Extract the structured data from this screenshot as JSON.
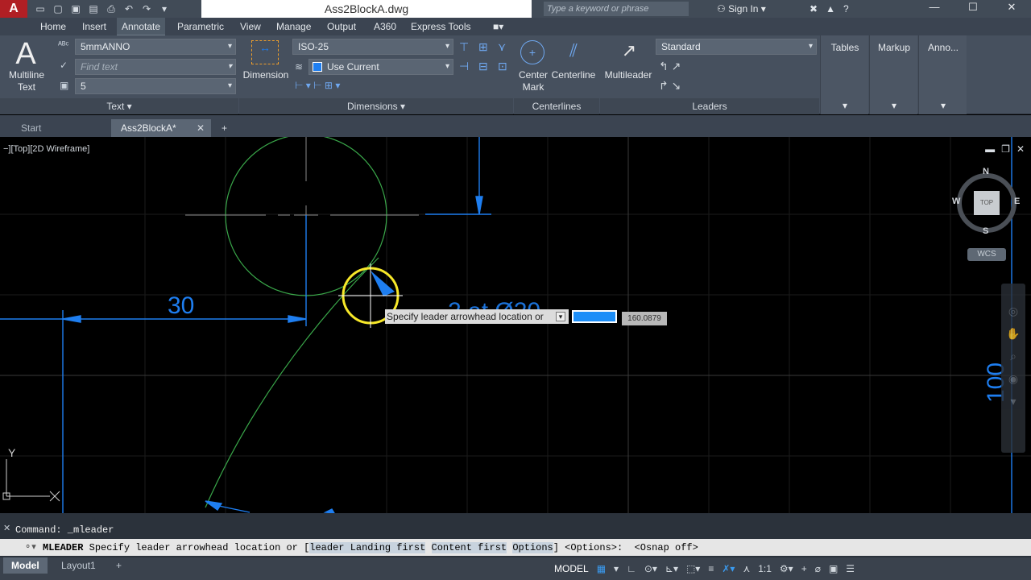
{
  "titlebar": {
    "app_letter": "A",
    "document_title": "Ass2BlockA.dwg",
    "search_placeholder": "Type a keyword or phrase",
    "sign_in": "Sign In"
  },
  "menu_tabs": [
    "Home",
    "Insert",
    "Annotate",
    "Parametric",
    "View",
    "Manage",
    "Output",
    "A360",
    "Express Tools"
  ],
  "active_tab": "Annotate",
  "ribbon": {
    "text_panel": {
      "multiline_label": "Multiline\nText",
      "style_combo": "5mmANNO",
      "find_placeholder": "Find text",
      "height_combo": "5",
      "footer": "Text ▾"
    },
    "dimensions_panel": {
      "dimension_label": "Dimension",
      "dimstyle_combo": "ISO-25",
      "layer_combo": "Use Current",
      "footer": "Dimensions ▾"
    },
    "centerlines_panel": {
      "center_mark_label": "Center\nMark",
      "centerline_label": "Centerline",
      "footer": "Centerlines"
    },
    "leaders_panel": {
      "multileader_label": "Multileader",
      "style_combo": "Standard",
      "footer": "Leaders"
    },
    "extra_panels": [
      "Tables",
      "Markup",
      "Anno..."
    ]
  },
  "file_tabs": {
    "start": "Start",
    "document": "Ass2BlockA*",
    "add": "+"
  },
  "viewport": {
    "label": "−][Top][2D Wireframe]",
    "viewcube": {
      "north": "N",
      "south": "S",
      "east": "E",
      "west": "W",
      "face": "TOP"
    },
    "wcs": "WCS",
    "dim_30": "30",
    "dim_100": "100",
    "axis_y": "Y",
    "axis_x": "X",
    "tooltip": "Specify leader arrowhead location or",
    "dynamic_value": "160.0879"
  },
  "command": {
    "history": "Command:  _mleader",
    "name": "MLEADER",
    "prompt": "Specify leader arrowhead location or [",
    "options": [
      "leader Landing first",
      "Content first",
      "Options"
    ],
    "tail": "] <Options>:  <Osnap off>"
  },
  "statusbar": {
    "model_tab": "Model",
    "layout_tab": "Layout1",
    "model_label": "MODEL",
    "scale": "1:1"
  },
  "colors": {
    "drawing_green": "#3aa84a",
    "dimension_blue": "#1e7ef0",
    "tooltip_yellow": "#f7e829"
  }
}
